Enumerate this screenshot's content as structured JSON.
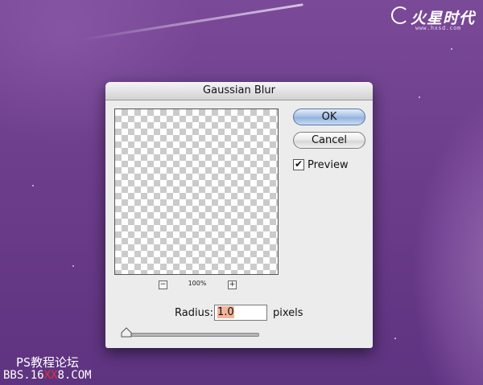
{
  "dialog": {
    "title": "Gaussian Blur",
    "ok_label": "OK",
    "cancel_label": "Cancel",
    "preview_label": "Preview",
    "preview_checked": true,
    "zoom_value": "100%",
    "zoom_out_symbol": "−",
    "zoom_in_symbol": "+",
    "radius_label": "Radius:",
    "radius_value": "1.0",
    "radius_unit": "pixels",
    "slider_level": 0.0
  },
  "watermark": {
    "line1": "PS教程论坛",
    "line2_prefix": "BBS.16",
    "line2_red": "XX",
    "line2_suffix": "8.COM"
  },
  "logo": {
    "text": "火星时代",
    "url": "www.hxsd.com"
  },
  "colors": {
    "background": "#6a3b87",
    "ok_button": "#a9c2e3",
    "selection": "#f2b49a",
    "watermark_red": "#dd3333"
  }
}
